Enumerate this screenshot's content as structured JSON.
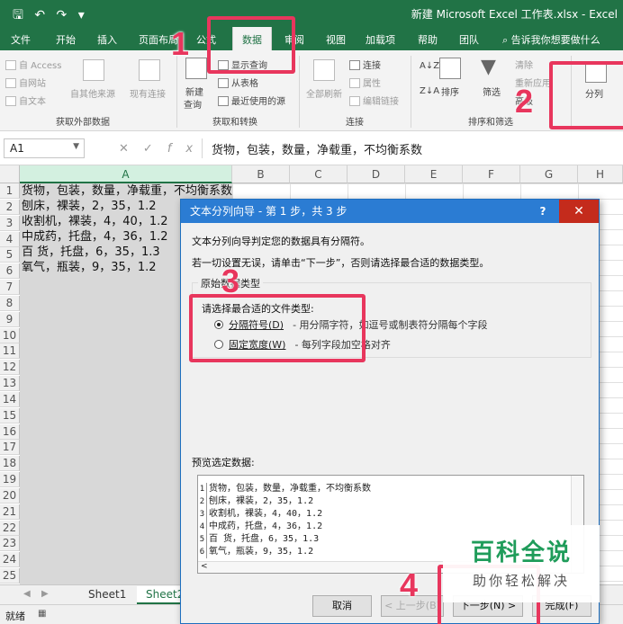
{
  "window": {
    "title": "新建 Microsoft Excel 工作表.xlsx - Excel"
  },
  "menu_tabs": [
    "文件",
    "开始",
    "插入",
    "页面布局",
    "公式",
    "数据",
    "审阅",
    "视图",
    "加载项",
    "帮助",
    "团队"
  ],
  "active_tab": "数据",
  "tell_me": "告诉我你想要做什么",
  "ribbon": {
    "get_external": {
      "access": "自 Access",
      "web": "自网站",
      "text": "自文本",
      "other": "自其他来源",
      "existing": "现有连接",
      "group": "获取外部数据"
    },
    "get_transform": {
      "new_query": "新建",
      "new_query2": "查询",
      "show_query": "显示查询",
      "from_table": "从表格",
      "recent": "最近使用的源",
      "group": "获取和转换"
    },
    "connections": {
      "refresh_all": "全部刷新",
      "connections": "连接",
      "properties": "属性",
      "edit_links": "编辑链接",
      "group": "连接"
    },
    "sort_filter": {
      "sort": "排序",
      "filter": "筛选",
      "clear": "清除",
      "reapply": "重新应用",
      "advanced": "高级",
      "group": "排序和筛选"
    },
    "tools": {
      "split": "分列"
    }
  },
  "formula_bar": {
    "name_box": "A1",
    "formula": "货物，包装，数量，净载重，不均衡系数"
  },
  "columns": [
    "A",
    "B",
    "C",
    "D",
    "E",
    "F",
    "G",
    "H"
  ],
  "rows": [
    "1",
    "2",
    "3",
    "4",
    "5",
    "6",
    "7",
    "8",
    "9",
    "10",
    "11",
    "12",
    "13",
    "14",
    "15",
    "16",
    "17",
    "18",
    "19",
    "20",
    "21",
    "22",
    "23",
    "24",
    "25"
  ],
  "cells": [
    "货物，包装，数量，净载重，不均衡系数",
    "刨床，裸装，2，35，1.2",
    "收割机，裸装，4，40，1.2",
    "中成药，托盘，4，36，1.2",
    "百  货，托盘，6，35，1.3",
    "氧气，瓶装，9，35，1.2"
  ],
  "sheet_tabs": [
    "Sheet1",
    "Sheet2"
  ],
  "status": "就绪",
  "dialog": {
    "title": "文本分列向导 - 第 1 步，共 3 步",
    "line1": "文本分列向导判定您的数据具有分隔符。",
    "line2": "若一切设置无误，请单击“下一步”，否则请选择最合适的数据类型。",
    "group_label": "原始数据类型",
    "choose_label": "请选择最合适的文件类型:",
    "opt_delimited": "分隔符号(D)",
    "opt_delimited_desc": "- 用分隔字符，如逗号或制表符分隔每个字段",
    "opt_fixed": "固定宽度(W)",
    "opt_fixed_desc": "- 每列字段加空格对齐",
    "preview_label": "预览选定数据:",
    "preview_nums": [
      "1",
      "2",
      "3",
      "4",
      "5",
      "6"
    ],
    "preview_rows": [
      "货物，包装，数量，净载重，不均衡系数",
      "刨床，裸装，2，35，1.2",
      "收割机，裸装，4，40，1.2",
      "中成药，托盘，4，36，1.2",
      "百  货，托盘，6，35，1.3",
      "氧气，瓶装，9，35，1.2"
    ],
    "btn_cancel": "取消",
    "btn_back": "< 上一步(B)",
    "btn_next": "下一步(N) >",
    "btn_finish": "完成(F)"
  },
  "annotations": [
    "1",
    "2",
    "3",
    "4"
  ],
  "watermark": {
    "line1": "百科全说",
    "line2": "助你轻松解决"
  },
  "colors": {
    "excel_green": "#217346",
    "annotation_pink": "#e8365d",
    "dialog_blue": "#2b7cd3"
  }
}
